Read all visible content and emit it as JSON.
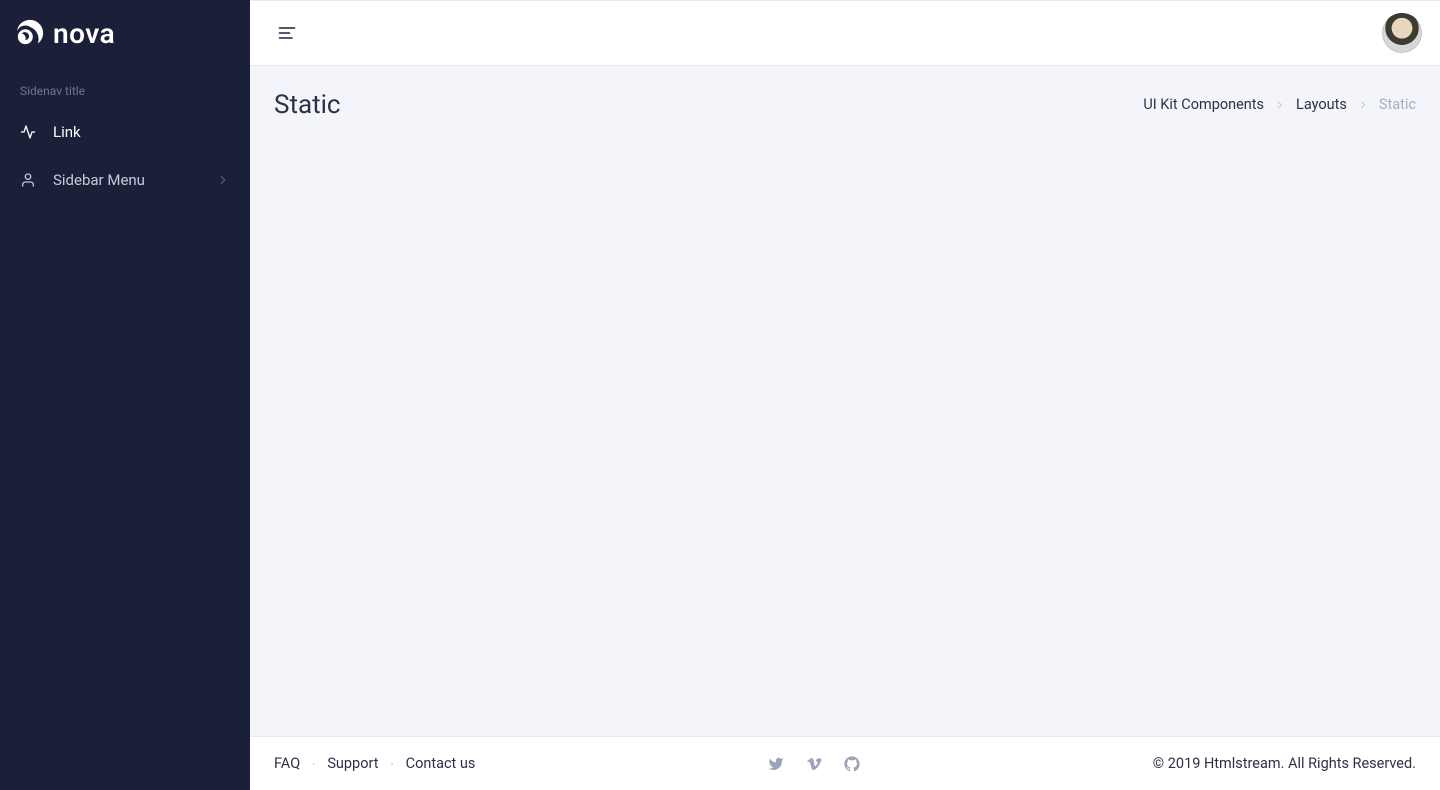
{
  "sidebar": {
    "brand": "nova",
    "section_title": "Sidenav title",
    "items": [
      {
        "label": "Link",
        "icon": "activity",
        "active": true,
        "has_children": false
      },
      {
        "label": "Sidebar Menu",
        "icon": "user",
        "active": false,
        "has_children": true
      }
    ]
  },
  "header": {},
  "page": {
    "title": "Static",
    "breadcrumb": [
      {
        "label": "UI Kit Components",
        "muted": false
      },
      {
        "label": "Layouts",
        "muted": false
      },
      {
        "label": "Static",
        "muted": true
      }
    ]
  },
  "footer": {
    "links": [
      {
        "label": "FAQ"
      },
      {
        "label": "Support"
      },
      {
        "label": "Contact us"
      }
    ],
    "social": [
      "twitter",
      "vimeo",
      "github"
    ],
    "copyright": "© 2019 Htmlstream. All Rights Reserved."
  }
}
